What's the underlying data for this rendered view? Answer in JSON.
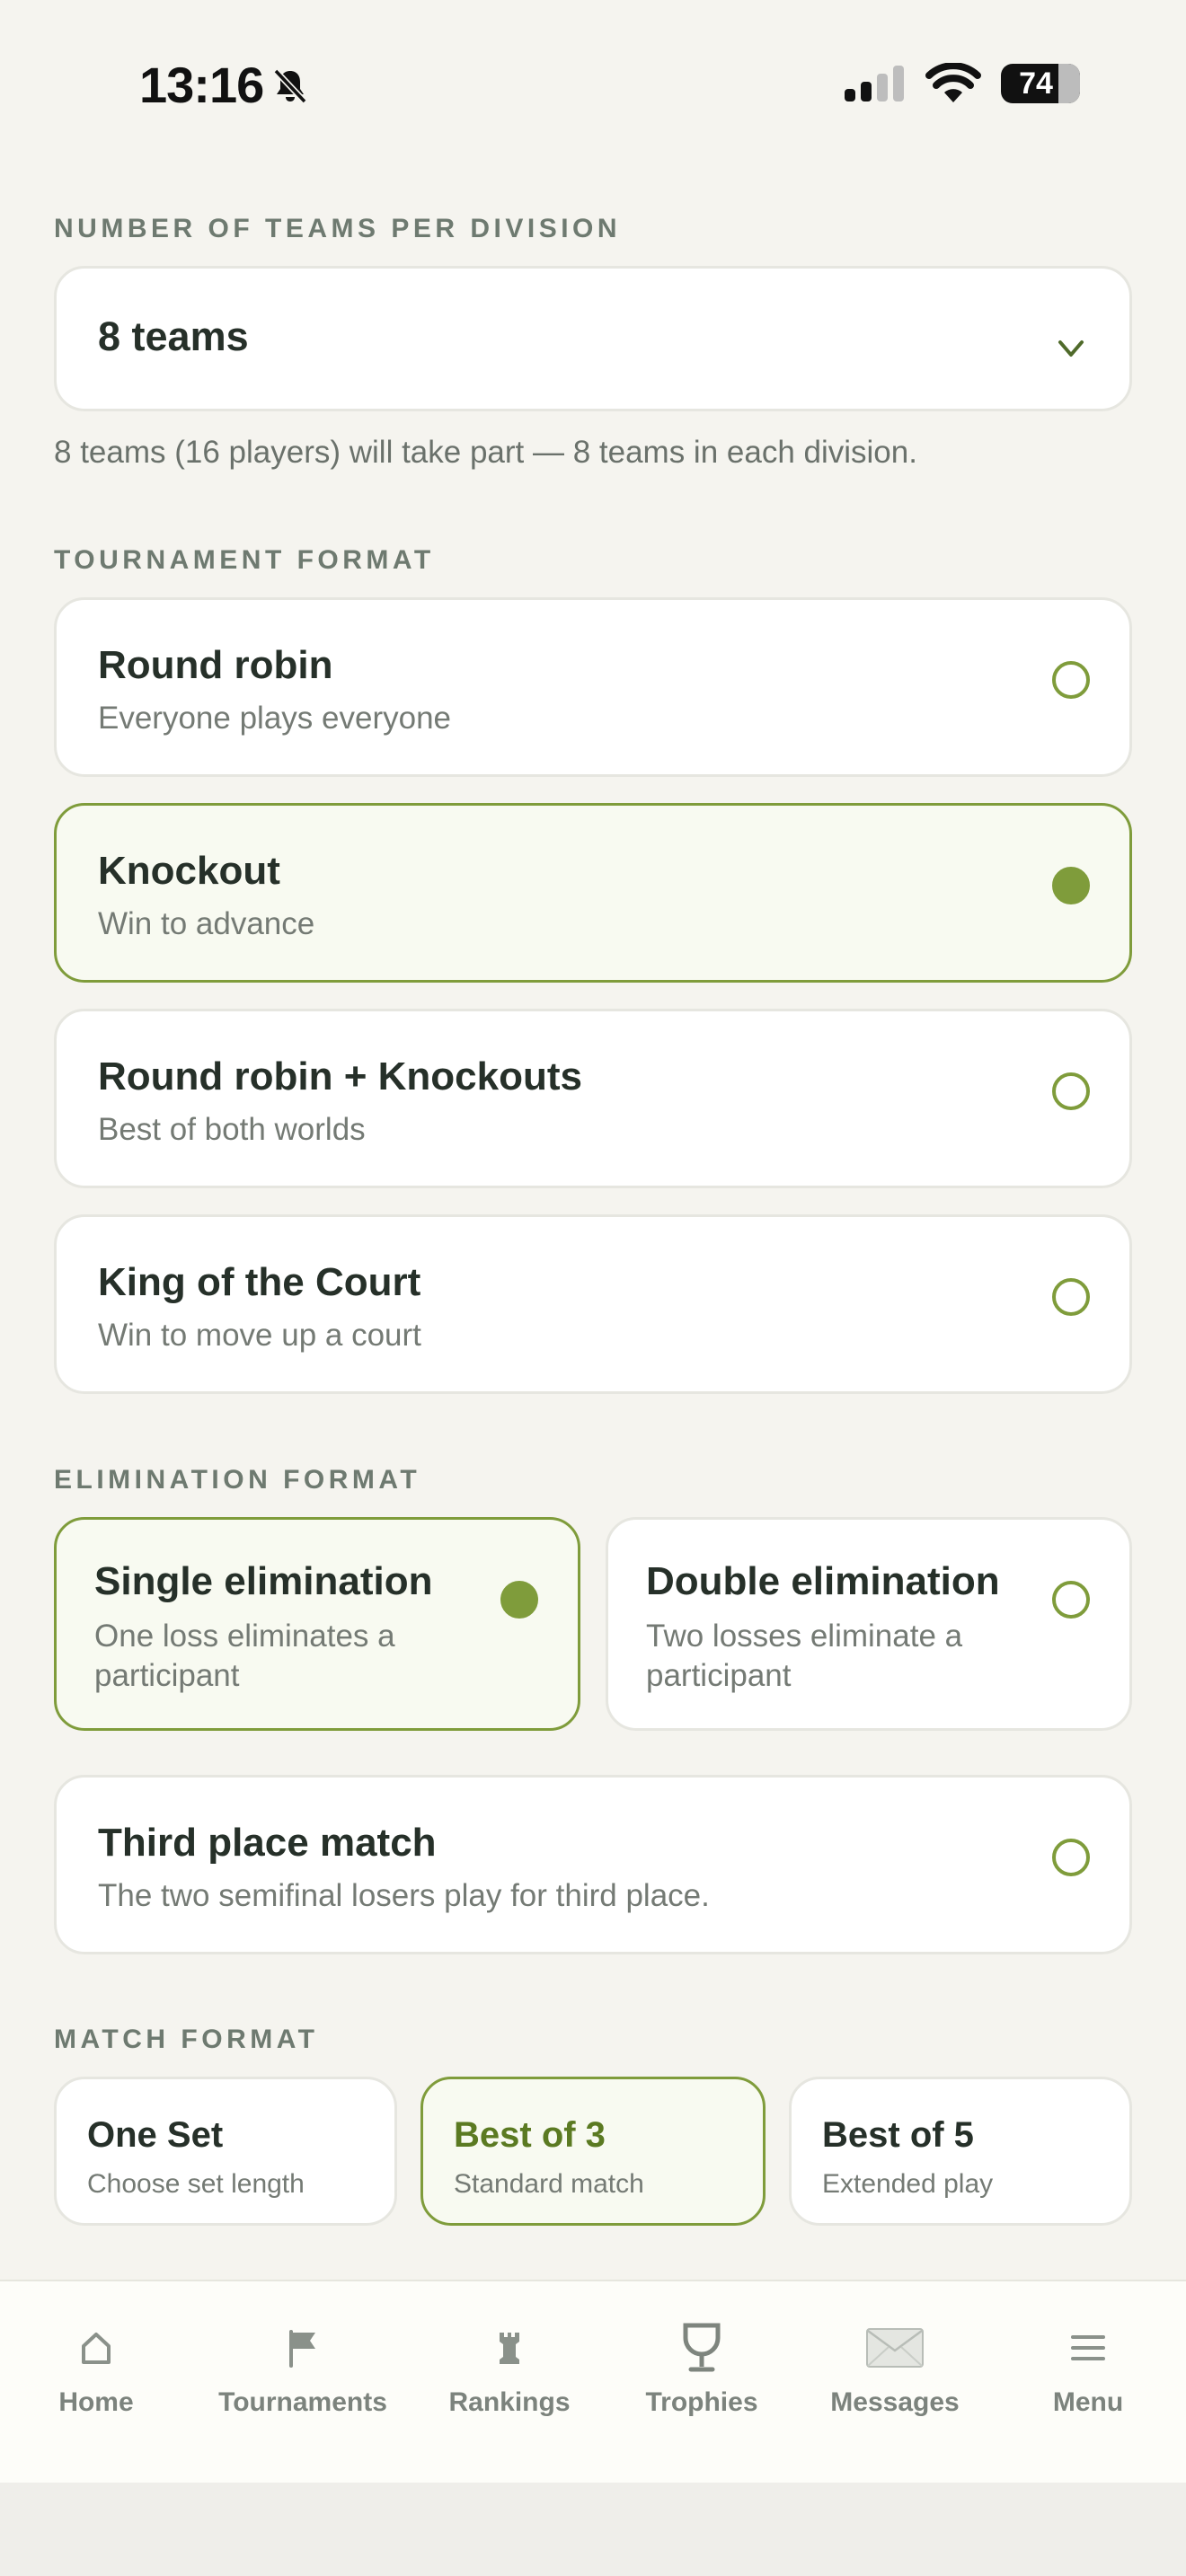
{
  "status_bar": {
    "time": "13:16",
    "battery": "74"
  },
  "teams_per_division": {
    "label": "NUMBER OF TEAMS PER DIVISION",
    "value": "8 teams",
    "helper": "8 teams (16 players) will take part — 8 teams in each division."
  },
  "tournament_format": {
    "label": "TOURNAMENT FORMAT",
    "options": [
      {
        "title": "Round robin",
        "subtitle": "Everyone plays everyone",
        "selected": false
      },
      {
        "title": "Knockout",
        "subtitle": "Win to advance",
        "selected": true
      },
      {
        "title": "Round robin + Knockouts",
        "subtitle": "Best of both worlds",
        "selected": false
      },
      {
        "title": "King of the Court",
        "subtitle": "Win to move up a court",
        "selected": false
      }
    ]
  },
  "elimination_format": {
    "label": "ELIMINATION FORMAT",
    "options": [
      {
        "title": "Single elimination",
        "subtitle": "One loss eliminates a participant",
        "selected": true
      },
      {
        "title": "Double elimination",
        "subtitle": "Two losses eliminate a participant",
        "selected": false
      }
    ]
  },
  "third_place": {
    "title": "Third place match",
    "subtitle": "The two semifinal losers play for third place.",
    "selected": false
  },
  "match_format": {
    "label": "MATCH FORMAT",
    "options": [
      {
        "title": "One Set",
        "subtitle": "Choose set length",
        "selected": false
      },
      {
        "title": "Best of 3",
        "subtitle": "Standard match",
        "selected": true
      },
      {
        "title": "Best of 5",
        "subtitle": "Extended play",
        "selected": false
      }
    ]
  },
  "tab_bar": {
    "items": [
      {
        "label": "Home",
        "icon": "home-icon"
      },
      {
        "label": "Tournaments",
        "icon": "flag-icon"
      },
      {
        "label": "Rankings",
        "icon": "chess-rook-icon"
      },
      {
        "label": "Trophies",
        "icon": "trophy-icon"
      },
      {
        "label": "Messages",
        "icon": "envelope-icon"
      },
      {
        "label": "Menu",
        "icon": "menu-icon"
      }
    ]
  },
  "colors": {
    "accent": "#7f9c3b",
    "background": "#f5f4ef",
    "card": "#ffffff",
    "selected_card": "#f8faf1"
  }
}
